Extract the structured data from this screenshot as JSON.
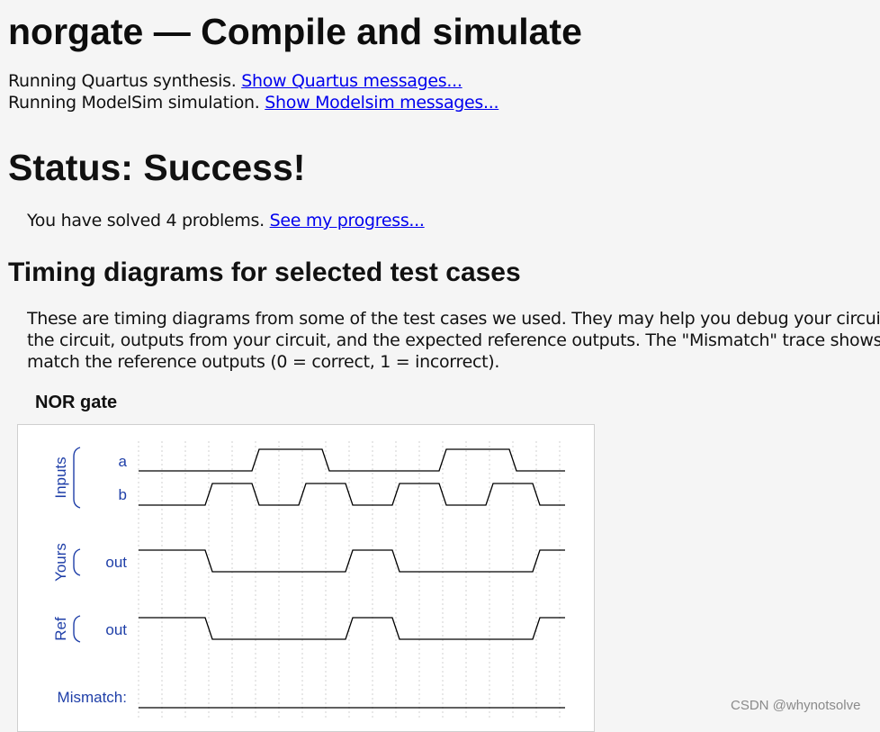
{
  "page": {
    "title": "norgate — Compile and simulate",
    "quartus_text": "Running Quartus synthesis.",
    "quartus_link": "Show Quartus messages...",
    "modelsim_text": "Running ModelSim simulation.",
    "modelsim_link": "Show Modelsim messages..."
  },
  "status": {
    "title": "Status: Success!",
    "solved_text": "You have solved 4 problems.",
    "progress_link": "See my progress..."
  },
  "timing": {
    "title": "Timing diagrams for selected test cases",
    "description_lines": [
      "These are timing diagrams from some of the test cases we used. They may help you debug your circuit.",
      "the circuit, outputs from your circuit, and the expected reference outputs. The \"Mismatch\" trace shows w",
      "match the reference outputs (0 = correct, 1 = incorrect)."
    ]
  },
  "diagram": {
    "title": "NOR gate",
    "groups": [
      {
        "label": "Inputs"
      },
      {
        "label": "Yours"
      },
      {
        "label": "Ref"
      }
    ],
    "signals": [
      {
        "group": "Inputs",
        "name": "a",
        "values": [
          0,
          0,
          0,
          0,
          0,
          1,
          1,
          1,
          0,
          0,
          0,
          0,
          0,
          1,
          1,
          1,
          0,
          0
        ]
      },
      {
        "group": "Inputs",
        "name": "b",
        "values": [
          0,
          0,
          0,
          1,
          1,
          0,
          0,
          1,
          1,
          0,
          0,
          1,
          1,
          0,
          0,
          1,
          1,
          0
        ]
      },
      {
        "group": "Yours",
        "name": "out",
        "values": [
          1,
          1,
          1,
          0,
          0,
          0,
          0,
          0,
          0,
          1,
          1,
          0,
          0,
          0,
          0,
          0,
          0,
          1
        ]
      },
      {
        "group": "Ref",
        "name": "out",
        "values": [
          1,
          1,
          1,
          0,
          0,
          0,
          0,
          0,
          0,
          1,
          1,
          0,
          0,
          0,
          0,
          0,
          0,
          1
        ]
      }
    ],
    "mismatch_label": "Mismatch:",
    "mismatch_values": [
      0,
      0,
      0,
      0,
      0,
      0,
      0,
      0,
      0,
      0,
      0,
      0,
      0,
      0,
      0,
      0,
      0,
      0
    ],
    "colors": {
      "label": "#1f3fa8",
      "trace": "#000000",
      "grid": "#d0d0d0"
    }
  },
  "watermark": "CSDN @whynotsolve"
}
